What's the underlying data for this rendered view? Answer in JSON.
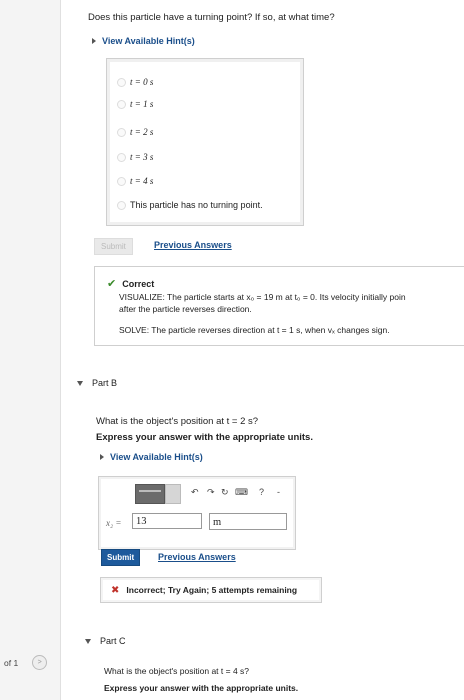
{
  "question": "Does this particle have a turning point? If so, at what time?",
  "hints_label": "View Available Hint(s)",
  "options": [
    {
      "label": "t = 0 s"
    },
    {
      "label": "t = 1 s"
    },
    {
      "label": "t = 2 s"
    },
    {
      "label": "t = 3 s"
    },
    {
      "label": "t = 4 s"
    },
    {
      "label": "This particle has no turning point."
    }
  ],
  "submit_label": "Submit",
  "previous_answers_label": "Previous Answers",
  "feedback": {
    "status": "Correct",
    "visualize": "VISUALIZE: The particle starts at x₀ = 19 m at t₀ = 0. Its velocity initially poin",
    "visualize2": "after the particle reverses direction.",
    "solve": "SOLVE: The particle reverses direction at t = 1 s, when vₓ changes sign."
  },
  "part_b": {
    "title": "Part B",
    "question": "What is the object's position at t = 2 s?",
    "instruction": "Express your answer with the appropriate units.",
    "hints_label": "View Available Hint(s)",
    "toolbar_help": "?",
    "toolbar_more": "-",
    "var_label": "x₂ =",
    "answer_value": "13",
    "unit_value": "m",
    "submit_label": "Submit",
    "previous_answers_label": "Previous Answers",
    "result": "Incorrect; Try Again; 5 attempts remaining"
  },
  "part_c": {
    "title": "Part C",
    "question": "What is the object's position at t = 4 s?",
    "instruction": "Express your answer with the appropriate units."
  },
  "page_indicator": {
    "text": "of 1",
    "button": ">"
  }
}
